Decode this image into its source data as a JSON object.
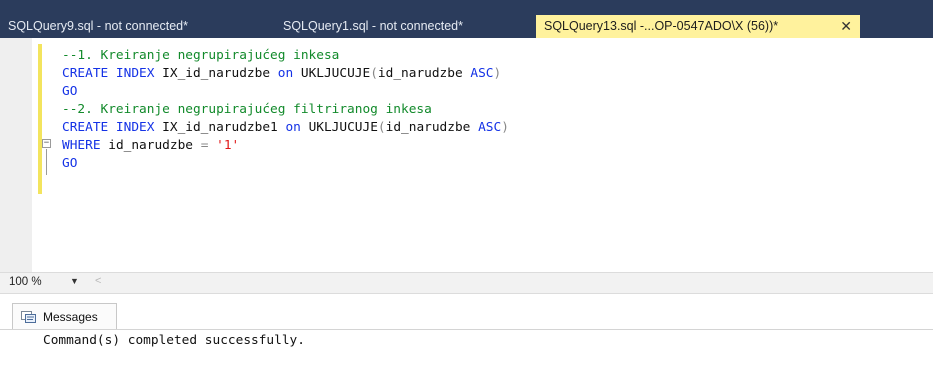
{
  "tabs": [
    {
      "label": "SQLQuery9.sql - not connected*",
      "active": false
    },
    {
      "label": "SQLQuery1.sql - not connected*",
      "active": false
    },
    {
      "label": "SQLQuery13.sql -...OP-0547ADO\\X (56))*",
      "active": true,
      "close": "✕"
    }
  ],
  "editor": {
    "fold_symbol": "−",
    "lines": [
      {
        "comment": "--1. Kreiranje negrupirajućeg inkesa"
      },
      {
        "kw1": "CREATE INDEX",
        "t1": " IX_id_narudzbe ",
        "kw2": "on",
        "t2": " UKLJUCUJE",
        "p1": "(",
        "t3": "id_narudzbe ",
        "kw3": "ASC",
        "p2": ")"
      },
      {
        "kw1": "GO"
      },
      {
        "comment": "--2. Kreiranje negrupirajućeg filtriranog inkesa"
      },
      {
        "kw1": "CREATE INDEX",
        "t1": " IX_id_narudzbe1 ",
        "kw2": "on",
        "t2": " UKLJUCUJE",
        "p1": "(",
        "t3": "id_narudzbe ",
        "kw3": "ASC",
        "p2": ")"
      },
      {
        "kw1": "WHERE",
        "t1": " id_narudzbe ",
        "op": "=",
        "sp": " ",
        "str": "'1'"
      },
      {
        "kw1": "GO"
      }
    ]
  },
  "status": {
    "zoom": "100 %",
    "zoom_arrow": "▼",
    "scroll_left": "<"
  },
  "results": {
    "tab_label": "Messages",
    "message": "Command(s) completed successfully."
  },
  "colors": {
    "tabbar_bg": "#2b3c5c",
    "active_tab_bg": "#fff29d",
    "keyword": "#1432e6",
    "comment": "#128a2b",
    "string": "#e01818"
  }
}
